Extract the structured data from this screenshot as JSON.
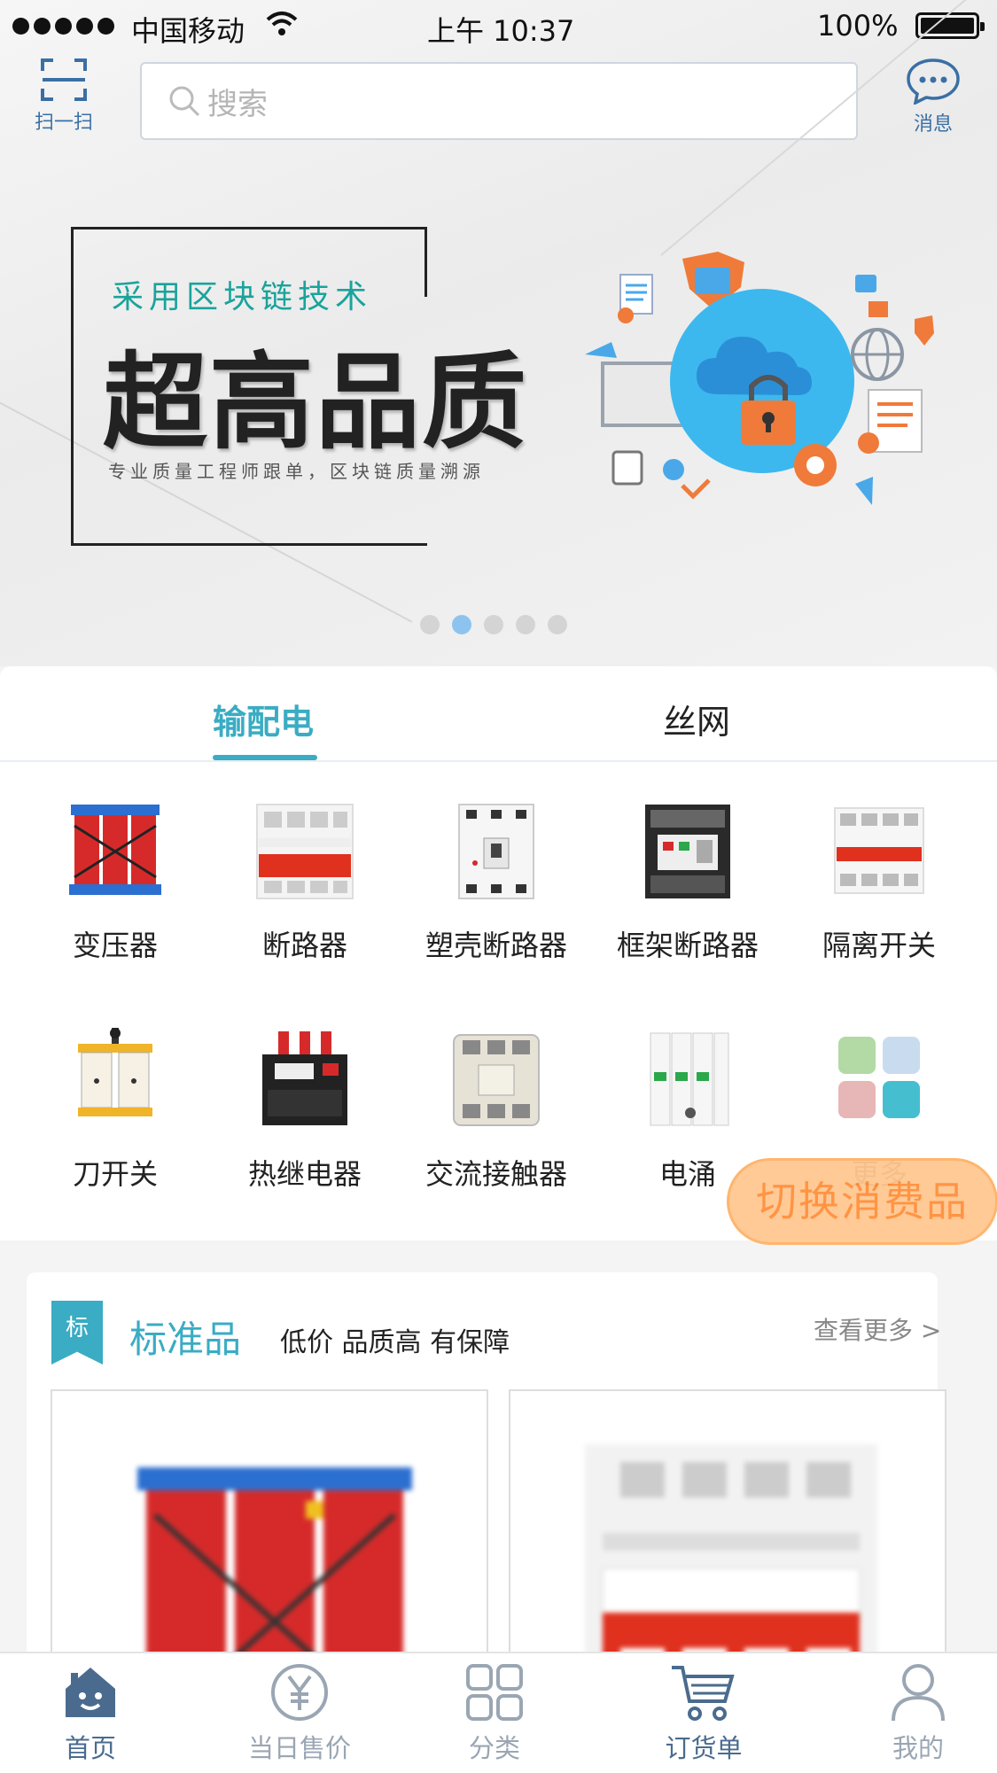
{
  "status_bar": {
    "carrier": "中国移动",
    "time": "上午 10:37",
    "battery": "100%"
  },
  "topbar": {
    "scan_label": "扫一扫",
    "search_placeholder": "搜索",
    "message_label": "消息"
  },
  "banner": {
    "subtitle": "采用区块链技术",
    "title": "超高品质",
    "description": "专业质量工程师跟单，区块链质量溯源",
    "active_dot": 1,
    "dot_count": 5
  },
  "tabs": [
    {
      "label": "输配电",
      "active": true
    },
    {
      "label": "丝网",
      "active": false
    }
  ],
  "categories": [
    {
      "label": "变压器",
      "icon": "transformer-icon"
    },
    {
      "label": "断路器",
      "icon": "circuit-breaker-icon"
    },
    {
      "label": "塑壳断路器",
      "icon": "mccb-icon"
    },
    {
      "label": "框架断路器",
      "icon": "acb-icon"
    },
    {
      "label": "隔离开关",
      "icon": "isolator-icon"
    },
    {
      "label": "刀开关",
      "icon": "knife-switch-icon"
    },
    {
      "label": "热继电器",
      "icon": "thermal-relay-icon"
    },
    {
      "label": "交流接触器",
      "icon": "contactor-icon"
    },
    {
      "label": "电涌",
      "icon": "surge-protector-icon"
    },
    {
      "label": "更多",
      "icon": "more-grid-icon"
    }
  ],
  "switch_button": "切换消费品",
  "standard": {
    "tag": "标",
    "title": "标准品",
    "slogan": "低价 品质高 有保障",
    "more": "查看更多 >"
  },
  "bottom_nav": [
    {
      "label": "首页",
      "icon": "home-icon",
      "active": true
    },
    {
      "label": "当日售价",
      "icon": "yuan-icon",
      "active": false
    },
    {
      "label": "分类",
      "icon": "grid-icon",
      "active": false
    },
    {
      "label": "订货单",
      "icon": "cart-icon",
      "active": false
    },
    {
      "label": "我的",
      "icon": "user-icon",
      "active": false
    }
  ],
  "colors": {
    "accent": "#3aacc3",
    "nav_active": "#4a6b8e",
    "switch_bg": "#ffc891",
    "switch_text": "#ff8f3a"
  }
}
